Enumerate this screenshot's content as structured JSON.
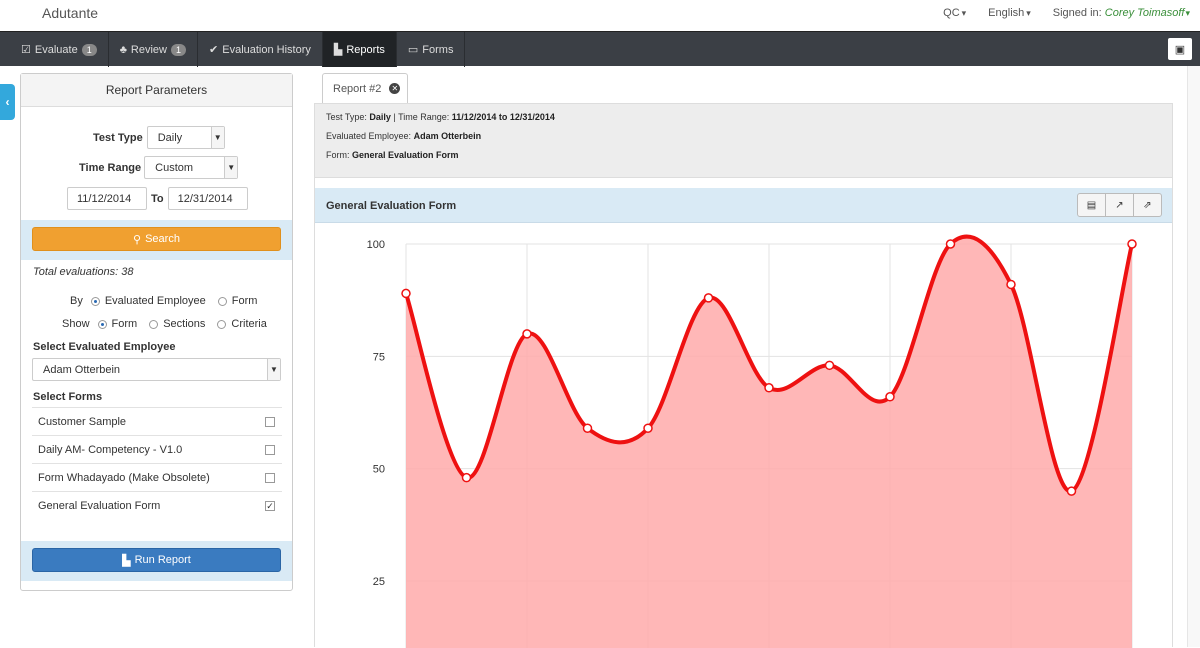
{
  "app": {
    "brand": "Adutante"
  },
  "topright": {
    "org": "QC",
    "language": "English",
    "signed_in_label": "Signed in:",
    "user": "Corey Toimasoff"
  },
  "nav": {
    "items": [
      {
        "label": "Evaluate",
        "icon": "check-square-icon",
        "badge": "1",
        "glyph": "☑"
      },
      {
        "label": "Review",
        "icon": "sitemap-icon",
        "badge": "1",
        "glyph": "♣"
      },
      {
        "label": "Evaluation History",
        "icon": "checkmark-icon",
        "badge": "",
        "glyph": "✔"
      },
      {
        "label": "Reports",
        "icon": "bar-chart-icon",
        "badge": "",
        "glyph": "▙"
      },
      {
        "label": "Forms",
        "icon": "comment-icon",
        "badge": "",
        "glyph": "▭"
      }
    ],
    "active": "Reports",
    "right_icon": "gift-icon"
  },
  "params": {
    "title": "Report Parameters",
    "test_type_label": "Test Type",
    "test_type_value": "Daily",
    "time_range_label": "Time Range",
    "time_range_value": "Custom",
    "date_from": "11/12/2014",
    "date_to_label": "To",
    "date_to": "12/31/2014",
    "search_label": "Search",
    "total_evaluations": "Total evaluations: 38",
    "by_label": "By",
    "by_options": [
      "Evaluated Employee",
      "Form"
    ],
    "show_label": "Show",
    "show_options": [
      "Form",
      "Sections",
      "Criteria"
    ],
    "employee_label": "Select Evaluated Employee",
    "employee_value": "Adam Otterbein",
    "forms_label": "Select Forms",
    "forms": [
      {
        "name": "Customer Sample",
        "checked": false
      },
      {
        "name": "Daily AM- Competency - V1.0",
        "checked": false
      },
      {
        "name": "Form Whadayado (Make Obsolete)",
        "checked": false
      },
      {
        "name": "General Evaluation Form",
        "checked": true
      }
    ],
    "run_label": "Run Report"
  },
  "report": {
    "tab_label": "Report #2",
    "info_test_type_label": "Test Type:",
    "info_test_type": "Daily",
    "info_time_range_label": "| Time Range:",
    "info_time_range": "11/12/2014 to 12/31/2014",
    "info_employee_label": "Evaluated Employee:",
    "info_employee": "Adam Otterbein",
    "info_form_label": "Form:",
    "info_form": "General Evaluation Form",
    "chart_title": "General Evaluation Form",
    "tools": [
      "export-pdf-icon",
      "chart-type-icon",
      "share-icon"
    ]
  },
  "chart_data": {
    "type": "area",
    "title": "General Evaluation Form",
    "xlabel": "",
    "ylabel": "",
    "ylim": [
      0,
      100
    ],
    "yticks": [
      25,
      50,
      75,
      100
    ],
    "grid": true,
    "color": "#ee1111",
    "fill": "#ffaaaa",
    "series": [
      {
        "values": [
          89,
          48,
          80,
          59,
          59,
          88,
          68,
          73,
          66,
          100,
          91,
          45,
          100
        ]
      }
    ]
  }
}
